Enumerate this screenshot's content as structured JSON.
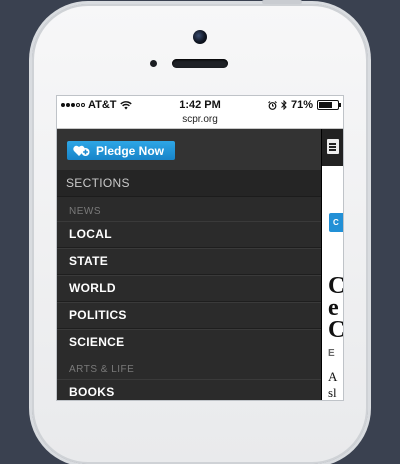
{
  "status_bar": {
    "carrier": "AT&T",
    "time": "1:42 PM",
    "battery": "71%",
    "battery_level": 0.71,
    "icons": [
      "signal-dots",
      "wifi-icon",
      "alarm-icon",
      "bluetooth-icon",
      "battery-icon"
    ]
  },
  "browser": {
    "url": "scpr.org"
  },
  "menu": {
    "pledge_label": "Pledge Now",
    "sections_label": "SECTIONS",
    "groups": [
      {
        "heading": "NEWS",
        "items": [
          "LOCAL",
          "STATE",
          "WORLD",
          "POLITICS",
          "SCIENCE"
        ]
      },
      {
        "heading": "ARTS & LIFE",
        "items": [
          "BOOKS"
        ]
      }
    ]
  },
  "content_peek": {
    "button_letter": "C",
    "headline_lines": [
      "C",
      "e",
      "C"
    ],
    "byline": "E",
    "body_lines": [
      "A",
      "sl"
    ]
  },
  "colors": {
    "pledge": "#1e90d8",
    "menu_bg": "#2b2b2b",
    "page_bg": "#3a4150"
  }
}
